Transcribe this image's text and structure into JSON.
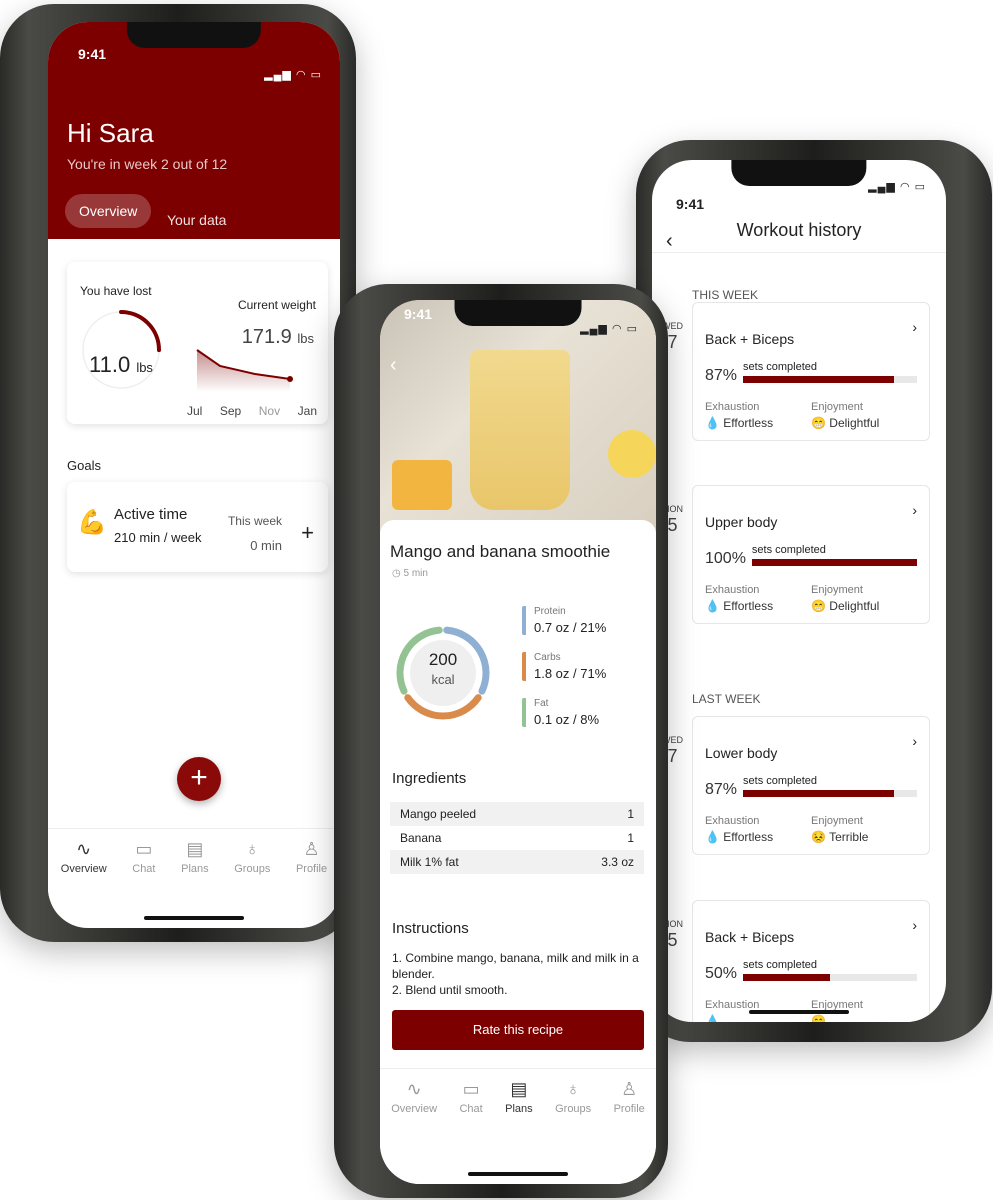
{
  "colors": {
    "brand": "#7d0000",
    "protein": "#8fb0d3",
    "carbs": "#d98b4b",
    "fat": "#93c293"
  },
  "phone1": {
    "status_time": "9:41",
    "greeting": "Hi Sara",
    "subtitle": "You're in week 2 out of 12",
    "tabs": [
      {
        "label": "Overview",
        "active": true
      },
      {
        "label": "Your data",
        "active": false
      }
    ],
    "lost": {
      "label": "You have lost",
      "value": "11.0",
      "unit": "lbs",
      "progress_fraction": 0.25
    },
    "weight": {
      "label": "Current weight",
      "value": "171.9",
      "unit": "lbs",
      "months": [
        "Jul",
        "Sep",
        "Nov",
        "Jan"
      ]
    },
    "goals_heading": "Goals",
    "goal": {
      "icon": "flexed-biceps-icon",
      "title": "Active time",
      "target_value": "210",
      "target_unit": "min / week",
      "week_label": "This week",
      "week_value": "0",
      "week_unit": "min"
    },
    "nav": [
      {
        "label": "Overview",
        "icon": "activity-icon"
      },
      {
        "label": "Chat",
        "icon": "chat-icon"
      },
      {
        "label": "Plans",
        "icon": "document-icon"
      },
      {
        "label": "Groups",
        "icon": "groups-icon"
      },
      {
        "label": "Profile",
        "icon": "profile-icon"
      }
    ]
  },
  "phone2": {
    "status_time": "9:41",
    "title": "Mango and banana smoothie",
    "time": "5 min",
    "kcal_value": "200",
    "kcal_unit": "kcal",
    "macros": [
      {
        "name": "Protein",
        "value": "0.7 oz / 21%"
      },
      {
        "name": "Carbs",
        "value": "1.8 oz / 71%"
      },
      {
        "name": "Fat",
        "value": "0.1 oz / 8%"
      }
    ],
    "ingredients_heading": "Ingredients",
    "ingredients": [
      {
        "name": "Mango peeled",
        "qty": "1"
      },
      {
        "name": "Banana",
        "qty": "1"
      },
      {
        "name": "Milk 1% fat",
        "qty": "3.3 oz"
      }
    ],
    "instructions_heading": "Instructions",
    "instructions": [
      "1. Combine mango, banana, milk and milk in a blender.",
      "2. Blend until smooth."
    ],
    "button": "Rate this recipe",
    "nav": [
      {
        "label": "Overview"
      },
      {
        "label": "Chat"
      },
      {
        "label": "Plans"
      },
      {
        "label": "Groups"
      },
      {
        "label": "Profile"
      }
    ]
  },
  "phone3": {
    "status_time": "9:41",
    "title": "Workout history",
    "this_week": "THIS WEEK",
    "last_week": "LAST WEEK",
    "progress_label": "sets completed",
    "exhaustion_label": "Exhaustion",
    "enjoyment_label": "Enjoyment",
    "workouts": [
      {
        "dow": "WED",
        "day": "7",
        "title": "Back + Biceps",
        "pct": "87%",
        "fraction": 0.87,
        "exhaustion": "Effortless",
        "enjoyment": "Delightful",
        "enjoy_icon": "grinning-face-icon"
      },
      {
        "dow": "MON",
        "day": "5",
        "title": "Upper body",
        "pct": "100%",
        "fraction": 1.0,
        "exhaustion": "Effortless",
        "enjoyment": "Delightful",
        "enjoy_icon": "grinning-face-icon"
      },
      {
        "dow": "WED",
        "day": "7",
        "title": "Lower body",
        "pct": "87%",
        "fraction": 0.87,
        "exhaustion": "Effortless",
        "enjoyment": "Terrible",
        "enjoy_icon": "frowning-face-icon"
      },
      {
        "dow": "MON",
        "day": "5",
        "title": "Back + Biceps",
        "pct": "50%",
        "fraction": 0.5,
        "exhaustion": "",
        "enjoyment": "",
        "enjoy_icon": "grinning-face-icon"
      }
    ]
  }
}
